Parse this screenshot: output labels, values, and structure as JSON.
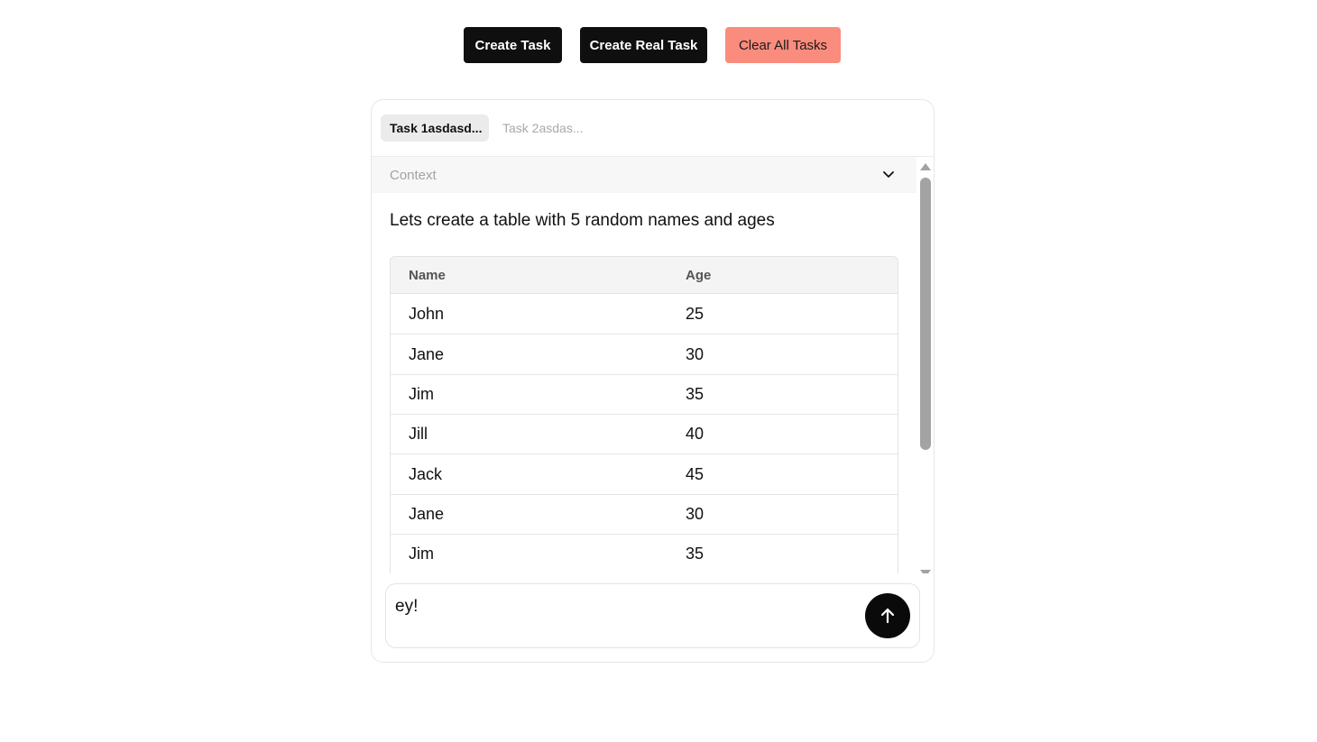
{
  "toolbar": {
    "create_task_label": "Create Task",
    "create_real_task_label": "Create Real Task",
    "clear_all_label": "Clear All Tasks"
  },
  "colors": {
    "dark_button": "#0f0f0f",
    "clear_button": "#fa8c7d",
    "send_button": "#0a0a0a"
  },
  "tabs": [
    {
      "label": "Task 1asdasd...",
      "active": true
    },
    {
      "label": "Task 2asdas...",
      "active": false
    }
  ],
  "context": {
    "label": "Context",
    "icon": "chevron-down-icon"
  },
  "message": {
    "text": "Lets create a table with 5 random names and ages"
  },
  "table": {
    "headers": {
      "name": "Name",
      "age": "Age"
    },
    "rows": [
      {
        "name": "John",
        "age": "25"
      },
      {
        "name": "Jane",
        "age": "30"
      },
      {
        "name": "Jim",
        "age": "35"
      },
      {
        "name": "Jill",
        "age": "40"
      },
      {
        "name": "Jack",
        "age": "45"
      },
      {
        "name": "Jane",
        "age": "30"
      },
      {
        "name": "Jim",
        "age": "35"
      },
      {
        "name": "",
        "age": ""
      }
    ]
  },
  "composer": {
    "value": "ey!",
    "send_icon": "arrow-up-icon"
  }
}
